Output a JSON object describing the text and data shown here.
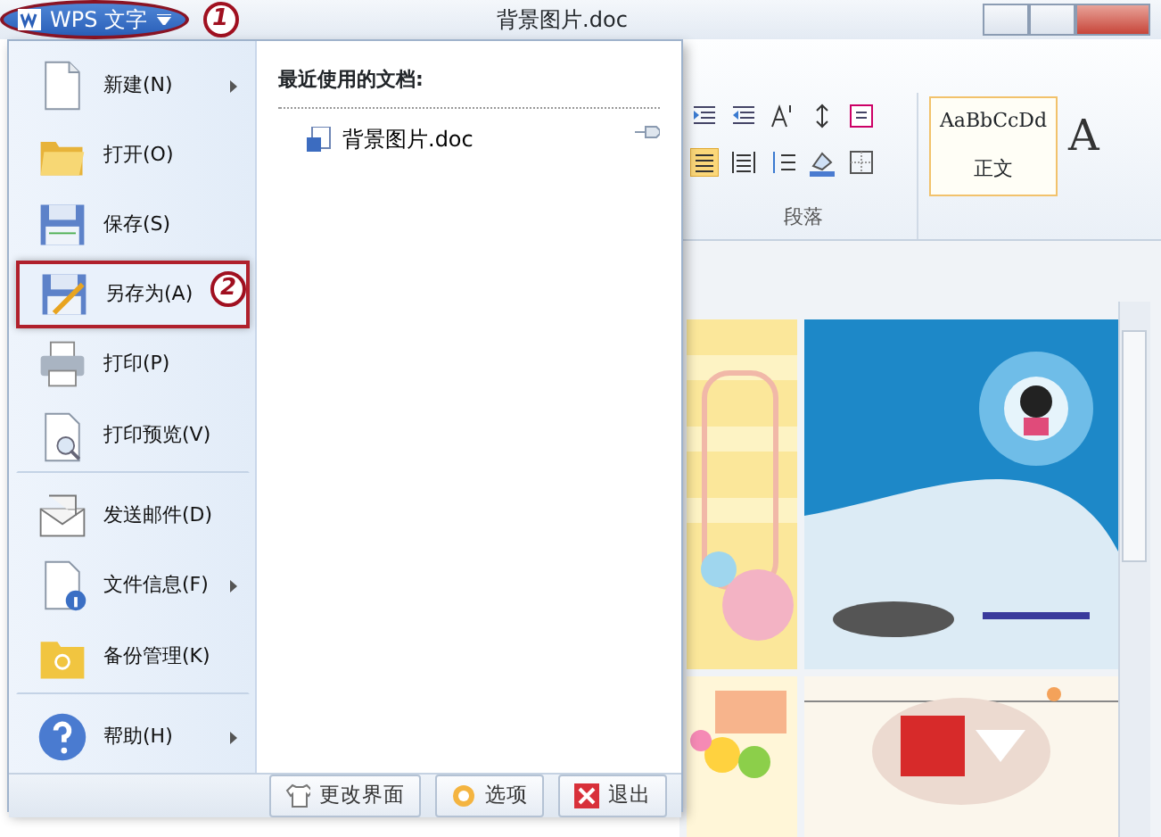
{
  "title_bar": {
    "app_button": "WPS 文字",
    "title": "背景图片.doc"
  },
  "callouts": [
    "1",
    "2"
  ],
  "menu": {
    "items": [
      {
        "label": "新建(N)",
        "submenu": true,
        "selected": false,
        "divider_after": false
      },
      {
        "label": "打开(O)",
        "submenu": false,
        "selected": false,
        "divider_after": false
      },
      {
        "label": "保存(S)",
        "submenu": false,
        "selected": false,
        "divider_after": false
      },
      {
        "label": "另存为(A)",
        "submenu": false,
        "selected": true,
        "divider_after": false
      },
      {
        "label": "打印(P)",
        "submenu": false,
        "selected": false,
        "divider_after": false
      },
      {
        "label": "打印预览(V)",
        "submenu": false,
        "selected": false,
        "divider_after": true
      },
      {
        "label": "发送邮件(D)",
        "submenu": false,
        "selected": false,
        "divider_after": false
      },
      {
        "label": "文件信息(F)",
        "submenu": true,
        "selected": false,
        "divider_after": false
      },
      {
        "label": "备份管理(K)",
        "submenu": false,
        "selected": false,
        "divider_after": true
      },
      {
        "label": "帮助(H)",
        "submenu": true,
        "selected": false,
        "divider_after": false
      }
    ],
    "recent": {
      "heading": "最近使用的文档:",
      "files": [
        {
          "name": "背景图片.doc"
        }
      ]
    },
    "footer_buttons": [
      "更改界面",
      "选项",
      "退出"
    ]
  },
  "ribbon": {
    "group_label": "段落",
    "style": {
      "sample": "AaBbCcDd",
      "name": "正文",
      "selected": true
    },
    "next_style_sample": "A"
  }
}
